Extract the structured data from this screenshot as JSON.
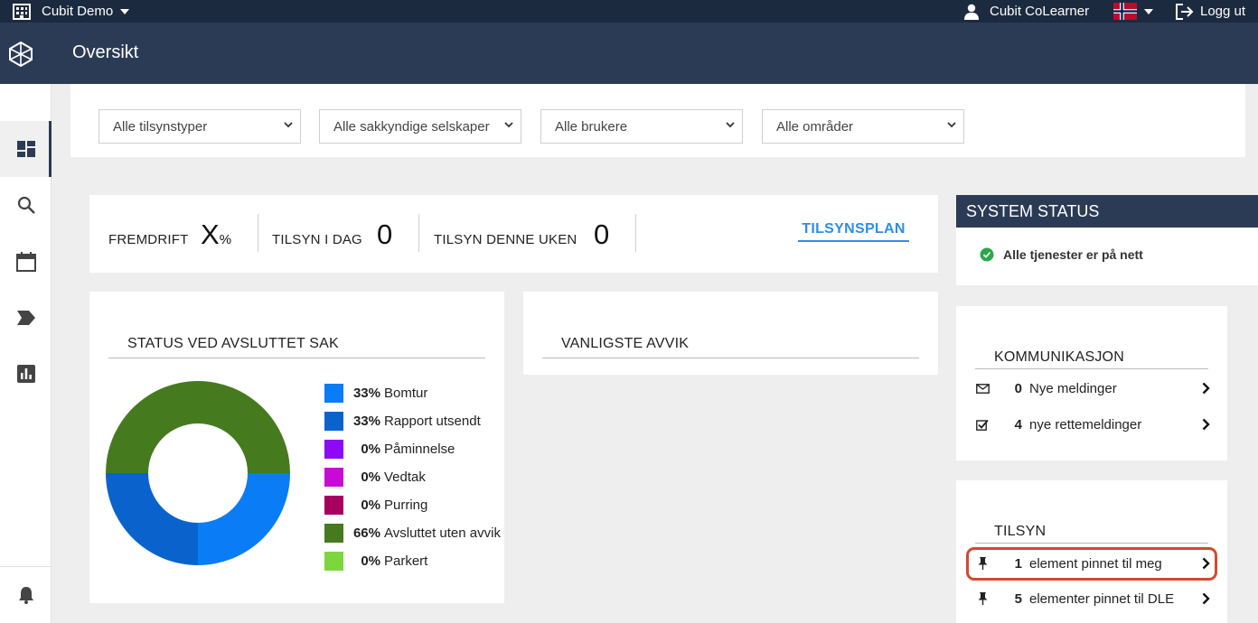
{
  "topbar": {
    "org_name": "Cubit Demo",
    "user_name": "Cubit CoLearner",
    "logout_label": "Logg ut"
  },
  "header": {
    "title": "Oversikt"
  },
  "sidebar": {
    "items": [
      {
        "name": "dashboard-icon",
        "active": true
      },
      {
        "name": "search-icon",
        "active": false
      },
      {
        "name": "calendar-icon",
        "active": false
      },
      {
        "name": "tag-icon",
        "active": false
      },
      {
        "name": "bar-chart-icon",
        "active": false
      },
      {
        "name": "bell-icon",
        "active": false
      }
    ]
  },
  "filters": [
    {
      "value": "Alle tilsynstyper"
    },
    {
      "value": "Alle sakkyndige selskaper"
    },
    {
      "value": "Alle brukere"
    },
    {
      "value": "Alle områder"
    }
  ],
  "stats": {
    "progress_label": "FREMDRIFT",
    "progress_value": "X",
    "progress_unit": "%",
    "today_label": "TILSYN I DAG",
    "today_value": "0",
    "week_label": "TILSYN DENNE UKEN",
    "week_value": "0",
    "plan_link": "TILSYNSPLAN"
  },
  "status_card": {
    "title": "STATUS VED AVSLUTTET SAK",
    "legend": [
      {
        "pct": "33%",
        "label": "Bomtur",
        "color": "#0a7cf5"
      },
      {
        "pct": "33%",
        "label": "Rapport utsendt",
        "color": "#0a63cc"
      },
      {
        "pct": "0%",
        "label": "Påminnelse",
        "color": "#8c0af5"
      },
      {
        "pct": "0%",
        "label": "Vedtak",
        "color": "#c80ad6"
      },
      {
        "pct": "0%",
        "label": "Purring",
        "color": "#a8005e"
      },
      {
        "pct": "66%",
        "label": "Avsluttet uten avvik",
        "color": "#467a1f"
      },
      {
        "pct": "0%",
        "label": "Parkert",
        "color": "#7ed63e"
      }
    ]
  },
  "chart_data": {
    "type": "pie",
    "labels": [
      "Bomtur",
      "Rapport utsendt",
      "Påminnelse",
      "Vedtak",
      "Purring",
      "Avsluttet uten avvik",
      "Parkert"
    ],
    "values": [
      33,
      33,
      0,
      0,
      0,
      66,
      0
    ],
    "colors": [
      "#0a7cf5",
      "#0a63cc",
      "#8c0af5",
      "#c80ad6",
      "#a8005e",
      "#467a1f",
      "#7ed63e"
    ],
    "donut": true
  },
  "avvik_card": {
    "title": "VANLIGSTE AVVIK"
  },
  "system_status": {
    "title": "SYSTEM STATUS",
    "message": "Alle tjenester er på nett",
    "ok_color": "#2aa84a"
  },
  "communication": {
    "title": "KOMMUNIKASJON",
    "rows": [
      {
        "icon": "envelope-icon",
        "count": "0",
        "label": "Nye meldinger"
      },
      {
        "icon": "checkbox-icon",
        "count": "4",
        "label": "nye rettemeldinger"
      }
    ]
  },
  "tilsyn": {
    "title": "TILSYN",
    "rows": [
      {
        "icon": "pin-icon",
        "count": "1",
        "label": "element pinnet til meg"
      },
      {
        "icon": "pin-icon",
        "count": "5",
        "label": "elementer pinnet til DLE"
      }
    ]
  },
  "colors": {
    "topbar": "#1c2a40",
    "header": "#2b3b55",
    "link": "#2f8ee6",
    "highlight": "#d24a2e"
  }
}
